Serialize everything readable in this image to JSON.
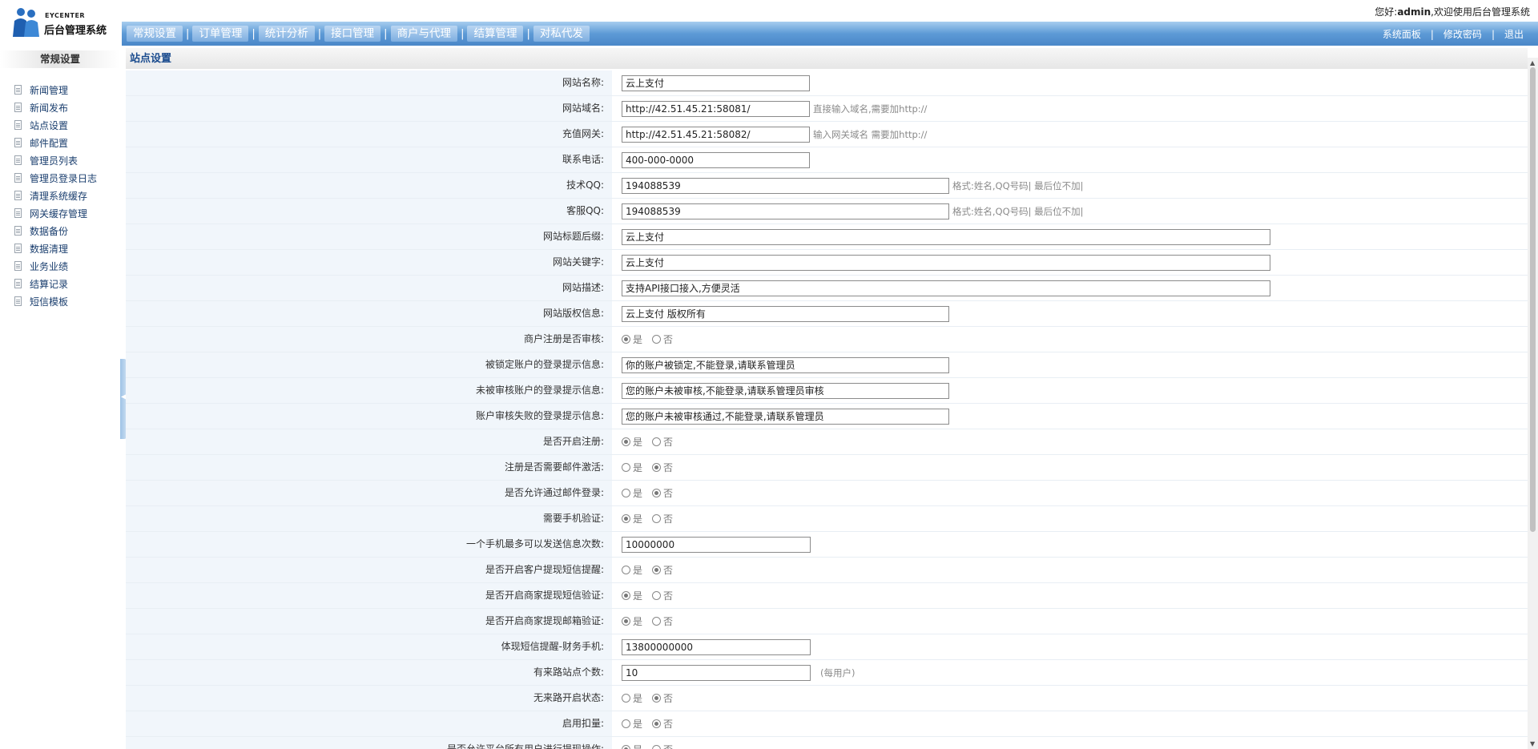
{
  "brand": {
    "en": "EYCENTER",
    "cn": "后台管理系统"
  },
  "welcome": {
    "prefix": "您好:",
    "user": "admin",
    "suffix": ",欢迎使用后台管理系统"
  },
  "topnav": {
    "items": [
      "常规设置",
      "订单管理",
      "统计分析",
      "接口管理",
      "商户与代理",
      "结算管理",
      "对私代发"
    ],
    "right": [
      "系统面板",
      "修改密码",
      "退出"
    ]
  },
  "sidebar": {
    "title": "常规设置",
    "items": [
      "新闻管理",
      "新闻发布",
      "站点设置",
      "邮件配置",
      "管理员列表",
      "管理员登录日志",
      "清理系统缓存",
      "网关缓存管理",
      "数据备份",
      "数据清理",
      "业务业绩",
      "结算记录",
      "短信模板"
    ]
  },
  "page": {
    "title": "站点设置"
  },
  "radio_labels": {
    "yes": "是",
    "no": "否"
  },
  "form": {
    "rows": [
      {
        "label": "网站名称:",
        "type": "text",
        "value": "云上支付",
        "width": "w1",
        "hint": ""
      },
      {
        "label": "网站域名:",
        "type": "text",
        "value": "http://42.51.45.21:58081/",
        "width": "w1",
        "hint": "直接输入域名,需要加http://"
      },
      {
        "label": "充值网关:",
        "type": "text",
        "value": "http://42.51.45.21:58082/",
        "width": "w1",
        "hint": "输入网关域名 需要加http://"
      },
      {
        "label": "联系电话:",
        "type": "text",
        "value": "400-000-0000",
        "width": "w1",
        "hint": ""
      },
      {
        "label": "技术QQ:",
        "type": "text",
        "value": "194088539",
        "width": "w2",
        "hint": "格式:姓名,QQ号码| 最后位不加|"
      },
      {
        "label": "客服QQ:",
        "type": "text",
        "value": "194088539",
        "width": "w2",
        "hint": "格式:姓名,QQ号码| 最后位不加|"
      },
      {
        "label": "网站标题后缀:",
        "type": "text",
        "value": "云上支付",
        "width": "w3",
        "hint": ""
      },
      {
        "label": "网站关键字:",
        "type": "text",
        "value": "云上支付",
        "width": "w3",
        "hint": ""
      },
      {
        "label": "网站描述:",
        "type": "text",
        "value": "支持API接口接入,方便灵活",
        "width": "w3",
        "hint": ""
      },
      {
        "label": "网站版权信息:",
        "type": "text",
        "value": "云上支付 版权所有",
        "width": "w2",
        "hint": ""
      },
      {
        "label": "商户注册是否审核:",
        "type": "radio",
        "selected": "yes"
      },
      {
        "label": "被锁定账户的登录提示信息:",
        "type": "text",
        "value": "你的账户被锁定,不能登录,请联系管理员",
        "width": "w2",
        "hint": ""
      },
      {
        "label": "未被审核账户的登录提示信息:",
        "type": "text",
        "value": "您的账户未被审核,不能登录,请联系管理员审核",
        "width": "w2",
        "hint": ""
      },
      {
        "label": "账户审核失败的登录提示信息:",
        "type": "text",
        "value": "您的账户未被审核通过,不能登录,请联系管理员",
        "width": "w2",
        "hint": ""
      },
      {
        "label": "是否开启注册:",
        "type": "radio",
        "selected": "yes"
      },
      {
        "label": "注册是否需要邮件激活:",
        "type": "radio",
        "selected": "no"
      },
      {
        "label": "是否允许通过邮件登录:",
        "type": "radio",
        "selected": "no"
      },
      {
        "label": "需要手机验证:",
        "type": "radio",
        "selected": "yes"
      },
      {
        "label": "一个手机最多可以发送信息次数:",
        "type": "text",
        "value": "10000000",
        "width": "w4",
        "hint": ""
      },
      {
        "label": "是否开启客户提现短信提醒:",
        "type": "radio",
        "selected": "no"
      },
      {
        "label": "是否开启商家提现短信验证:",
        "type": "radio",
        "selected": "yes"
      },
      {
        "label": "是否开启商家提现邮箱验证:",
        "type": "radio",
        "selected": "yes"
      },
      {
        "label": "体现短信提醒-财务手机:",
        "type": "text",
        "value": "13800000000",
        "width": "w4",
        "hint": ""
      },
      {
        "label": "有来路站点个数:",
        "type": "text",
        "value": "10",
        "width": "w4",
        "hint": "(每用户)",
        "hintStyle": "hint2"
      },
      {
        "label": "无来路开启状态:",
        "type": "radio",
        "selected": "no"
      },
      {
        "label": "启用扣量:",
        "type": "radio",
        "selected": "no"
      },
      {
        "label": "是否允许平台所有用户进行提现操作:",
        "type": "radio",
        "selected": "yes"
      }
    ]
  }
}
